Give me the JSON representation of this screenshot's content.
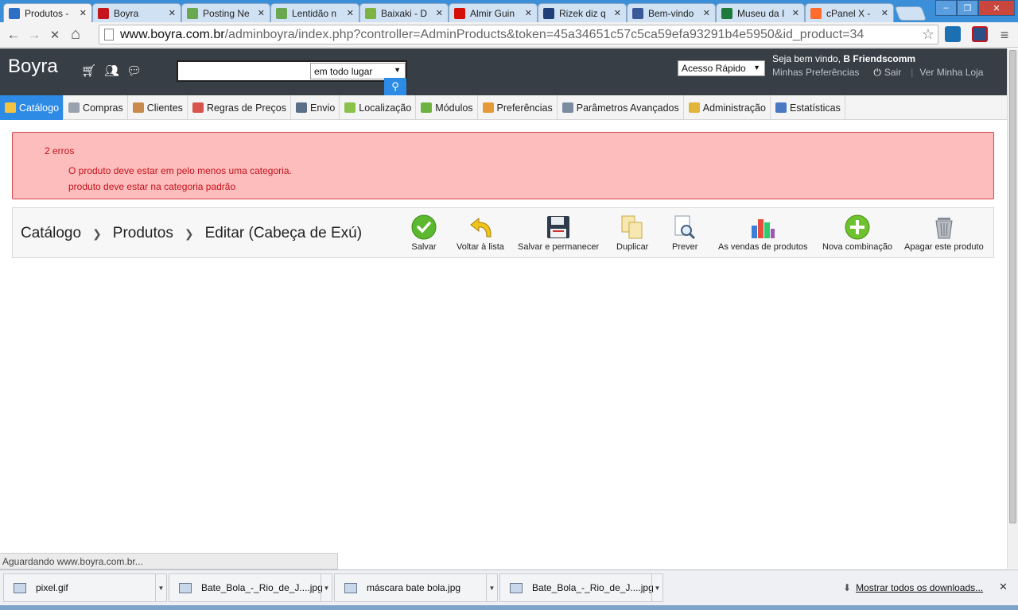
{
  "browser": {
    "tabs": [
      {
        "title": "Produtos -",
        "icon": "loading-icon",
        "color": "#2d6fc4",
        "active": true
      },
      {
        "title": "Boyra",
        "icon": "b-logo-icon",
        "color": "#c4161c"
      },
      {
        "title": "Posting Ne",
        "icon": "blogger-icon",
        "color": "#6aa84f"
      },
      {
        "title": "Lentidão n",
        "icon": "blogger-icon",
        "color": "#6aa84f"
      },
      {
        "title": "Baixaki - D",
        "icon": "baixaki-icon",
        "color": "#7cb342"
      },
      {
        "title": "Almir Guin",
        "icon": "lastfm-icon",
        "color": "#d51007"
      },
      {
        "title": "Rizek diz q",
        "icon": "news-icon",
        "color": "#1f3f7a"
      },
      {
        "title": "Bem-vindo",
        "icon": "facebook-icon",
        "color": "#3b5998"
      },
      {
        "title": "Museu da I",
        "icon": "museum-icon",
        "color": "#1e7a3c"
      },
      {
        "title": "cPanel X -",
        "icon": "cpanel-icon",
        "color": "#ff6c2c"
      }
    ],
    "tab_close": "✕",
    "window_controls": {
      "minimize": "–",
      "maximize": "❐",
      "close": "✕"
    },
    "url_host": "www.boyra.com.br",
    "url_path": "/adminboyra/index.php?controller=AdminProducts&token=45a34651c57c5ca59efa93291b4e5950&id_product=34",
    "nav": {
      "back": "←",
      "forward": "→",
      "stop": "✕",
      "home": "⌂",
      "star": "☆",
      "menu": "≡"
    }
  },
  "admin_header": {
    "brand": "Boyra",
    "search_placeholder": "",
    "search_scope": "em todo lugar",
    "quick_access": "Acesso Rápido",
    "welcome_prefix": "Seja bem vindo,",
    "welcome_user": "B Friendscomm",
    "link_preferences": "Minhas Preferências",
    "link_logout": "Sair",
    "link_store": "Ver Minha Loja"
  },
  "menu": [
    {
      "label": "Catálogo",
      "icon": "folder-icon",
      "color": "#f5c342",
      "active": true
    },
    {
      "label": "Compras",
      "icon": "cart-icon",
      "color": "#9aa3ad"
    },
    {
      "label": "Clientes",
      "icon": "user-icon",
      "color": "#c98a4b"
    },
    {
      "label": "Regras de Preços",
      "icon": "price-rules-icon",
      "color": "#d9534f"
    },
    {
      "label": "Envio",
      "icon": "truck-icon",
      "color": "#5b6f86"
    },
    {
      "label": "Localização",
      "icon": "globe-icon",
      "color": "#8bc34a"
    },
    {
      "label": "Módulos",
      "icon": "puzzle-icon",
      "color": "#6cb33f"
    },
    {
      "label": "Preferências",
      "icon": "preferences-icon",
      "color": "#e59a3a"
    },
    {
      "label": "Parâmetros Avançados",
      "icon": "wrench-icon",
      "color": "#7a8aa0"
    },
    {
      "label": "Administração",
      "icon": "key-icon",
      "color": "#e2b43a"
    },
    {
      "label": "Estatísticas",
      "icon": "bar-chart-icon",
      "color": "#4a78c2"
    }
  ],
  "errors": {
    "count_label": "2 erros",
    "items": [
      "O produto deve estar em pelo menos uma categoria.",
      "produto deve estar na categoria padrão"
    ]
  },
  "breadcrumb": [
    "Catálogo",
    "Produtos",
    "Editar (Cabeça de Exú)"
  ],
  "toolbar": [
    {
      "label": "Salvar",
      "icon": "save-check-icon"
    },
    {
      "label": "Voltar à lista",
      "icon": "back-arrow-icon"
    },
    {
      "label": "Salvar e permanecer",
      "icon": "floppy-disk-icon"
    },
    {
      "label": "Duplicar",
      "icon": "duplicate-icon"
    },
    {
      "label": "Prever",
      "icon": "preview-magnifier-icon"
    },
    {
      "label": "As vendas de produtos",
      "icon": "sales-chart-icon"
    },
    {
      "label": "Nova combinação",
      "icon": "add-combination-icon"
    },
    {
      "label": "Apagar este produto",
      "icon": "trash-icon"
    }
  ],
  "status_text": "Aguardando www.boyra.com.br...",
  "downloads": {
    "items": [
      {
        "name": "pixel.gif"
      },
      {
        "name": "Bate_Bola_-_Rio_de_J....jpg"
      },
      {
        "name": "máscara bate bola.jpg"
      },
      {
        "name": "Bate_Bola_-_Rio_de_J....jpg"
      }
    ],
    "show_all": "Mostrar todos os downloads...",
    "close": "✕"
  }
}
